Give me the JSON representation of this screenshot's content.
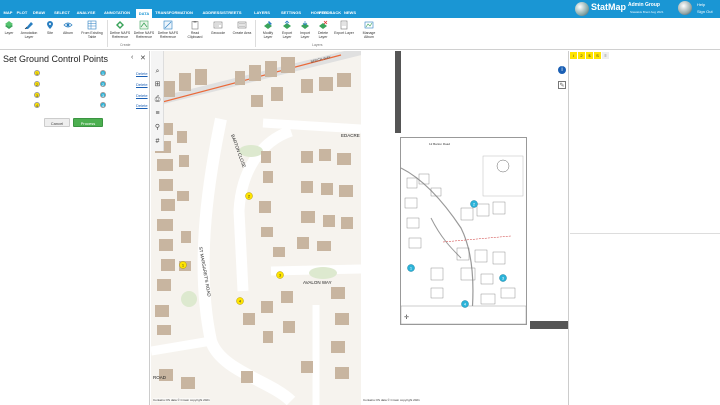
{
  "menubar": {
    "tabs": [
      "MAP",
      "PLOT",
      "DRAW",
      "SELECT",
      "ANALYSE",
      "ANNOTATION",
      "DATA",
      "TRANSFORMATION",
      "ADDRESS/STREETS",
      "LAYERS",
      "SETTINGS",
      "HOW TO",
      "FEEDBACK",
      "NEWS"
    ],
    "active_tab": "DATA",
    "logo_name": "StatMap",
    "logo_sub": "",
    "user_name": "Admin Group",
    "user_sub": "Stasiakis Brent Aug 2021",
    "help_label": "Help",
    "signout_label": "Sign Out"
  },
  "ribbon": {
    "buttons": [
      "Layer",
      "Annotation Layer",
      "Site",
      "Album",
      "From Existing Table",
      "Define NAFS Reference",
      "Define NAFS Reference",
      "Read Clipboard",
      "Geocode",
      "Create Area",
      "Modify Layer",
      "Export Layer",
      "Import Layer",
      "Delete Layer",
      "Export Layer",
      "Manage Album"
    ],
    "group_new": "Create",
    "group_layers": "Layers"
  },
  "left_panel": {
    "title": "Set Ground Control Points",
    "prev_label": "‹",
    "close_label": "✕",
    "points": [
      "1",
      "2",
      "3",
      "4"
    ],
    "targets": [
      "1",
      "2",
      "3",
      "4"
    ],
    "links": [
      "Delete",
      "Delete",
      "Delete",
      "Delete"
    ],
    "cancel_label": "Cancel",
    "process_label": "Process"
  },
  "map": {
    "street_labels": [
      "BARTON CLOSE",
      "ST MARGARET'S ROAD",
      "AVALON WAY",
      "EDACRE",
      "ROAD",
      "BEECH WAY"
    ],
    "markers": [
      "1",
      "2",
      "3",
      "4"
    ],
    "copyright": "Contains OS data © Crown copyright 2021",
    "tools": [
      "search-icon",
      "extent-icon",
      "print-icon",
      "menu-icon",
      "zoom-icon",
      "grid-icon"
    ]
  },
  "source_image": {
    "title": "12 Barton Road",
    "markers": [
      "1",
      "2",
      "3",
      "4"
    ],
    "copyright": "Contains OS data © Crown copyright 2021"
  },
  "right_panel": {
    "tabs": [
      "i",
      "2",
      "$",
      "S",
      "≡"
    ],
    "side_icons": [
      "info-icon",
      "edit-icon"
    ],
    "divider_label": ""
  },
  "colors": {
    "brand": "#1a96d4",
    "gcp_source": "#ffe400",
    "gcp_target": "#2bb3d9",
    "process": "#4caf50",
    "road": "#f2f2f2",
    "building": "#c8b5a0",
    "boundary": "#ea6a3a"
  }
}
